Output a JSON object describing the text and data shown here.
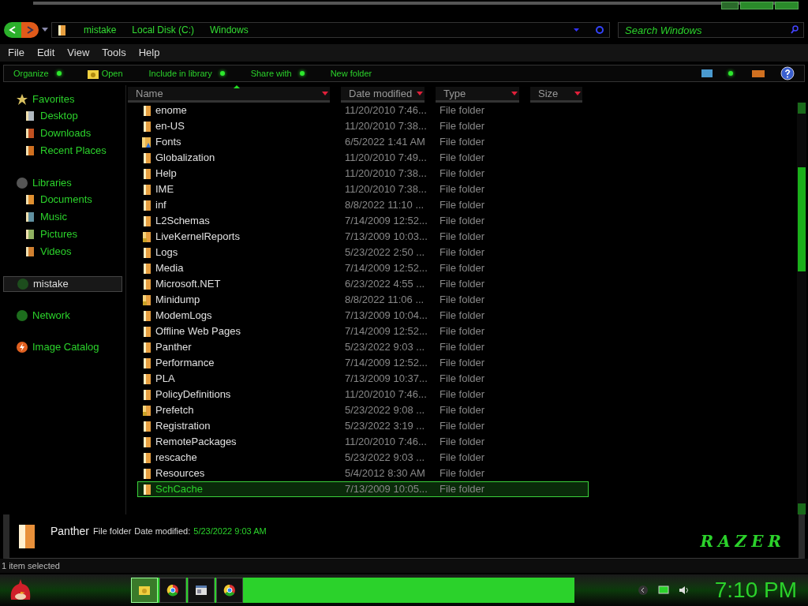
{
  "nav": {
    "breadcrumbs": [
      "mistake",
      "Local Disk (C:)",
      "Windows"
    ],
    "search": {
      "placeholder": "Search Windows"
    }
  },
  "menu": [
    "File",
    "Edit",
    "View",
    "Tools",
    "Help"
  ],
  "toolbar": [
    {
      "label": "Organize",
      "kind": "dropdown"
    },
    {
      "label": "Open",
      "kind": "open"
    },
    {
      "label": "Include in library",
      "kind": "dropdown"
    },
    {
      "label": "Share with",
      "kind": "dropdown"
    },
    {
      "label": "New folder",
      "kind": "plain"
    }
  ],
  "sidebar": [
    {
      "label": "Favorites",
      "kind": "favorites",
      "selected": false,
      "children": [
        {
          "label": "Desktop",
          "kind": "desktop"
        },
        {
          "label": "Downloads",
          "kind": "downloads"
        },
        {
          "label": "Recent Places",
          "kind": "recent"
        }
      ]
    },
    {
      "label": "Libraries",
      "kind": "libraries",
      "selected": false,
      "children": [
        {
          "label": "Documents",
          "kind": "documents"
        },
        {
          "label": "Music",
          "kind": "music"
        },
        {
          "label": "Pictures",
          "kind": "pictures"
        },
        {
          "label": "Videos",
          "kind": "videos"
        }
      ]
    },
    {
      "label": "mistake",
      "kind": "computer",
      "selected": true
    },
    {
      "label": "Network",
      "kind": "network",
      "selected": false
    },
    {
      "label": "Image Catalog",
      "kind": "catalog",
      "selected": false
    }
  ],
  "table": {
    "columns": [
      "Name",
      "Date modified",
      "Type",
      "Size"
    ],
    "rows": [
      {
        "name": "enome",
        "date": "11/20/2010 7:46...",
        "type": "File folder",
        "kind": "folder",
        "selected": false
      },
      {
        "name": "en-US",
        "date": "11/20/2010 7:38...",
        "type": "File folder",
        "kind": "folder",
        "selected": false
      },
      {
        "name": "Fonts",
        "date": "6/5/2022 1:41 AM",
        "type": "File folder",
        "kind": "fonts",
        "selected": false
      },
      {
        "name": "Globalization",
        "date": "11/20/2010 7:49...",
        "type": "File folder",
        "kind": "folder",
        "selected": false
      },
      {
        "name": "Help",
        "date": "11/20/2010 7:38...",
        "type": "File folder",
        "kind": "folder",
        "selected": false
      },
      {
        "name": "IME",
        "date": "11/20/2010 7:38...",
        "type": "File folder",
        "kind": "folder",
        "selected": false
      },
      {
        "name": "inf",
        "date": "8/8/2022 11:10 ...",
        "type": "File folder",
        "kind": "folder",
        "selected": false
      },
      {
        "name": "L2Schemas",
        "date": "7/14/2009 12:52...",
        "type": "File folder",
        "kind": "folder",
        "selected": false
      },
      {
        "name": "LiveKernelReports",
        "date": "7/13/2009 10:03...",
        "type": "File folder",
        "kind": "locked",
        "selected": false
      },
      {
        "name": "Logs",
        "date": "5/23/2022 2:50 ...",
        "type": "File folder",
        "kind": "folder",
        "selected": false
      },
      {
        "name": "Media",
        "date": "7/14/2009 12:52...",
        "type": "File folder",
        "kind": "folder",
        "selected": false
      },
      {
        "name": "Microsoft.NET",
        "date": "6/23/2022 4:55 ...",
        "type": "File folder",
        "kind": "folder",
        "selected": false
      },
      {
        "name": "Minidump",
        "date": "8/8/2022 11:06 ...",
        "type": "File folder",
        "kind": "locked",
        "selected": false
      },
      {
        "name": "ModemLogs",
        "date": "7/13/2009 10:04...",
        "type": "File folder",
        "kind": "folder",
        "selected": false
      },
      {
        "name": "Offline Web Pages",
        "date": "7/14/2009 12:52...",
        "type": "File folder",
        "kind": "folder",
        "selected": false
      },
      {
        "name": "Panther",
        "date": "5/23/2022 9:03 ...",
        "type": "File folder",
        "kind": "folder",
        "selected": false
      },
      {
        "name": "Performance",
        "date": "7/14/2009 12:52...",
        "type": "File folder",
        "kind": "folder",
        "selected": false
      },
      {
        "name": "PLA",
        "date": "7/13/2009 10:37...",
        "type": "File folder",
        "kind": "folder",
        "selected": false
      },
      {
        "name": "PolicyDefinitions",
        "date": "11/20/2010 7:46...",
        "type": "File folder",
        "kind": "folder",
        "selected": false
      },
      {
        "name": "Prefetch",
        "date": "5/23/2022 9:08 ...",
        "type": "File folder",
        "kind": "locked",
        "selected": false
      },
      {
        "name": "Registration",
        "date": "5/23/2022 3:19 ...",
        "type": "File folder",
        "kind": "folder",
        "selected": false
      },
      {
        "name": "RemotePackages",
        "date": "11/20/2010 7:46...",
        "type": "File folder",
        "kind": "folder",
        "selected": false
      },
      {
        "name": "rescache",
        "date": "5/23/2022 9:03 ...",
        "type": "File folder",
        "kind": "folder",
        "selected": false
      },
      {
        "name": "Resources",
        "date": "5/4/2012 8:30 AM",
        "type": "File folder",
        "kind": "folder",
        "selected": false
      },
      {
        "name": "SchCache",
        "date": "7/13/2009 10:05...",
        "type": "File folder",
        "kind": "folder",
        "selected": true
      }
    ]
  },
  "details": {
    "name": "Panther",
    "type": "File folder",
    "date_label": "Date modified:",
    "date": "5/23/2022 9:03 AM",
    "logo": "RAZER"
  },
  "status_bar": "1 item selected",
  "taskbar": {
    "buttons": [
      {
        "kind": "explorer",
        "selected": true
      },
      {
        "kind": "chrome",
        "selected": false
      },
      {
        "kind": "window",
        "selected": false
      },
      {
        "kind": "chrome",
        "selected": false
      }
    ],
    "clock": "7:10 PM"
  }
}
